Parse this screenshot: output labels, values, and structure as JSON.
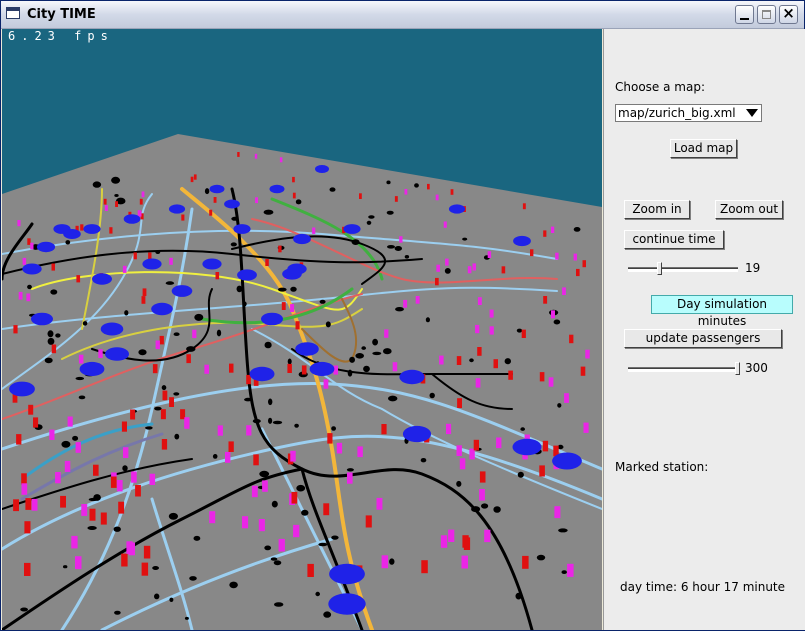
{
  "window": {
    "title": "City TIME"
  },
  "viewport": {
    "fps": "6.23 fps",
    "colors": {
      "sky": "#1a6680",
      "ground": "#888888",
      "bus": "#1f22e8",
      "passenger_red": "#e01010",
      "passenger_pink": "#ea26e6"
    }
  },
  "panel": {
    "choose_map_label": "Choose a map:",
    "map_select": {
      "value": "map/zurich_big.xml"
    },
    "load_map_button": "Load map",
    "zoom_in_button": "Zoom in",
    "zoom_out_button": "Zoom out",
    "continue_time_button": "continue time",
    "speed_slider": {
      "value": 19,
      "fraction": 0.27
    },
    "day_sim_label": "Day simulation minutes",
    "update_passengers_button": "update passengers",
    "minutes_slider": {
      "value": 300,
      "fraction": 1.0
    },
    "marked_station_label": "Marked station:",
    "day_time": "day time: 6 hour  17 minute"
  }
}
